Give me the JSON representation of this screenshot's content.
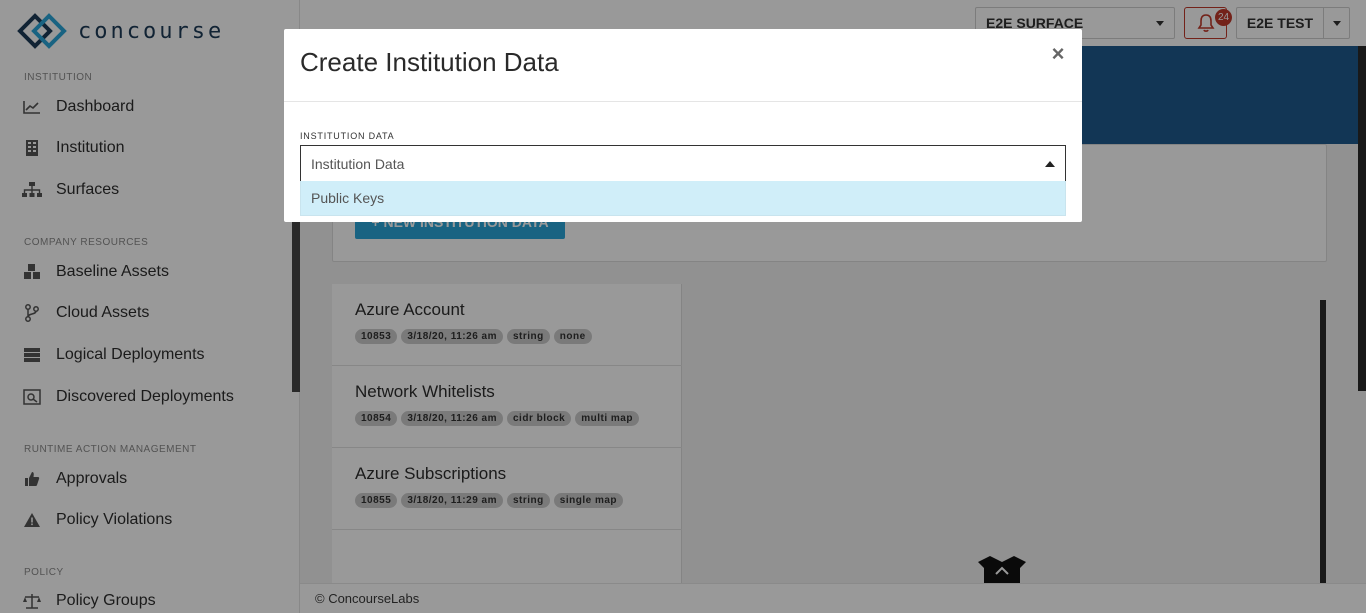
{
  "brand": {
    "name": "concourse"
  },
  "sidebar": {
    "sections": [
      {
        "title": "INSTITUTION",
        "items": [
          {
            "label": "Dashboard",
            "icon": "chart-line-icon"
          },
          {
            "label": "Institution",
            "icon": "building-icon"
          },
          {
            "label": "Surfaces",
            "icon": "sitemap-icon"
          }
        ]
      },
      {
        "title": "COMPANY RESOURCES",
        "items": [
          {
            "label": "Baseline Assets",
            "icon": "cubes-icon"
          },
          {
            "label": "Cloud Assets",
            "icon": "code-branch-icon"
          },
          {
            "label": "Logical Deployments",
            "icon": "server-icon"
          },
          {
            "label": "Discovered Deployments",
            "icon": "search-deployments-icon"
          }
        ]
      },
      {
        "title": "RUNTIME ACTION MANAGEMENT",
        "items": [
          {
            "label": "Approvals",
            "icon": "thumbs-up-icon"
          },
          {
            "label": "Policy Violations",
            "icon": "warning-icon"
          }
        ]
      },
      {
        "title": "POLICY",
        "items": [
          {
            "label": "Policy Groups",
            "icon": "balance-scale-icon"
          }
        ]
      }
    ]
  },
  "topbar": {
    "surface": "E2E SURFACE",
    "notifications": "24",
    "user": "E2E TEST"
  },
  "content": {
    "new_button": "+ NEW INSTITUTION DATA",
    "items": [
      {
        "title": "Azure Account",
        "tags": [
          "10853",
          "3/18/20, 11:26 am",
          "string",
          "none"
        ]
      },
      {
        "title": "Network Whitelists",
        "tags": [
          "10854",
          "3/18/20, 11:26 am",
          "cidr block",
          "multi map"
        ]
      },
      {
        "title": "Azure Subscriptions",
        "tags": [
          "10855",
          "3/18/20, 11:29 am",
          "string",
          "single map"
        ]
      }
    ]
  },
  "footer": {
    "text": "© ConcourseLabs"
  },
  "modal": {
    "title": "Create Institution Data",
    "close": "×",
    "field_label": "INSTITUTION DATA",
    "select_placeholder": "Institution Data",
    "options": [
      "Public Keys"
    ]
  },
  "colors": {
    "accent": "#2aa6d9",
    "brand_dark": "#1d3b57",
    "hero": "#1f5b8e",
    "alert": "#c0392b",
    "option_highlight": "#d0eef9"
  }
}
